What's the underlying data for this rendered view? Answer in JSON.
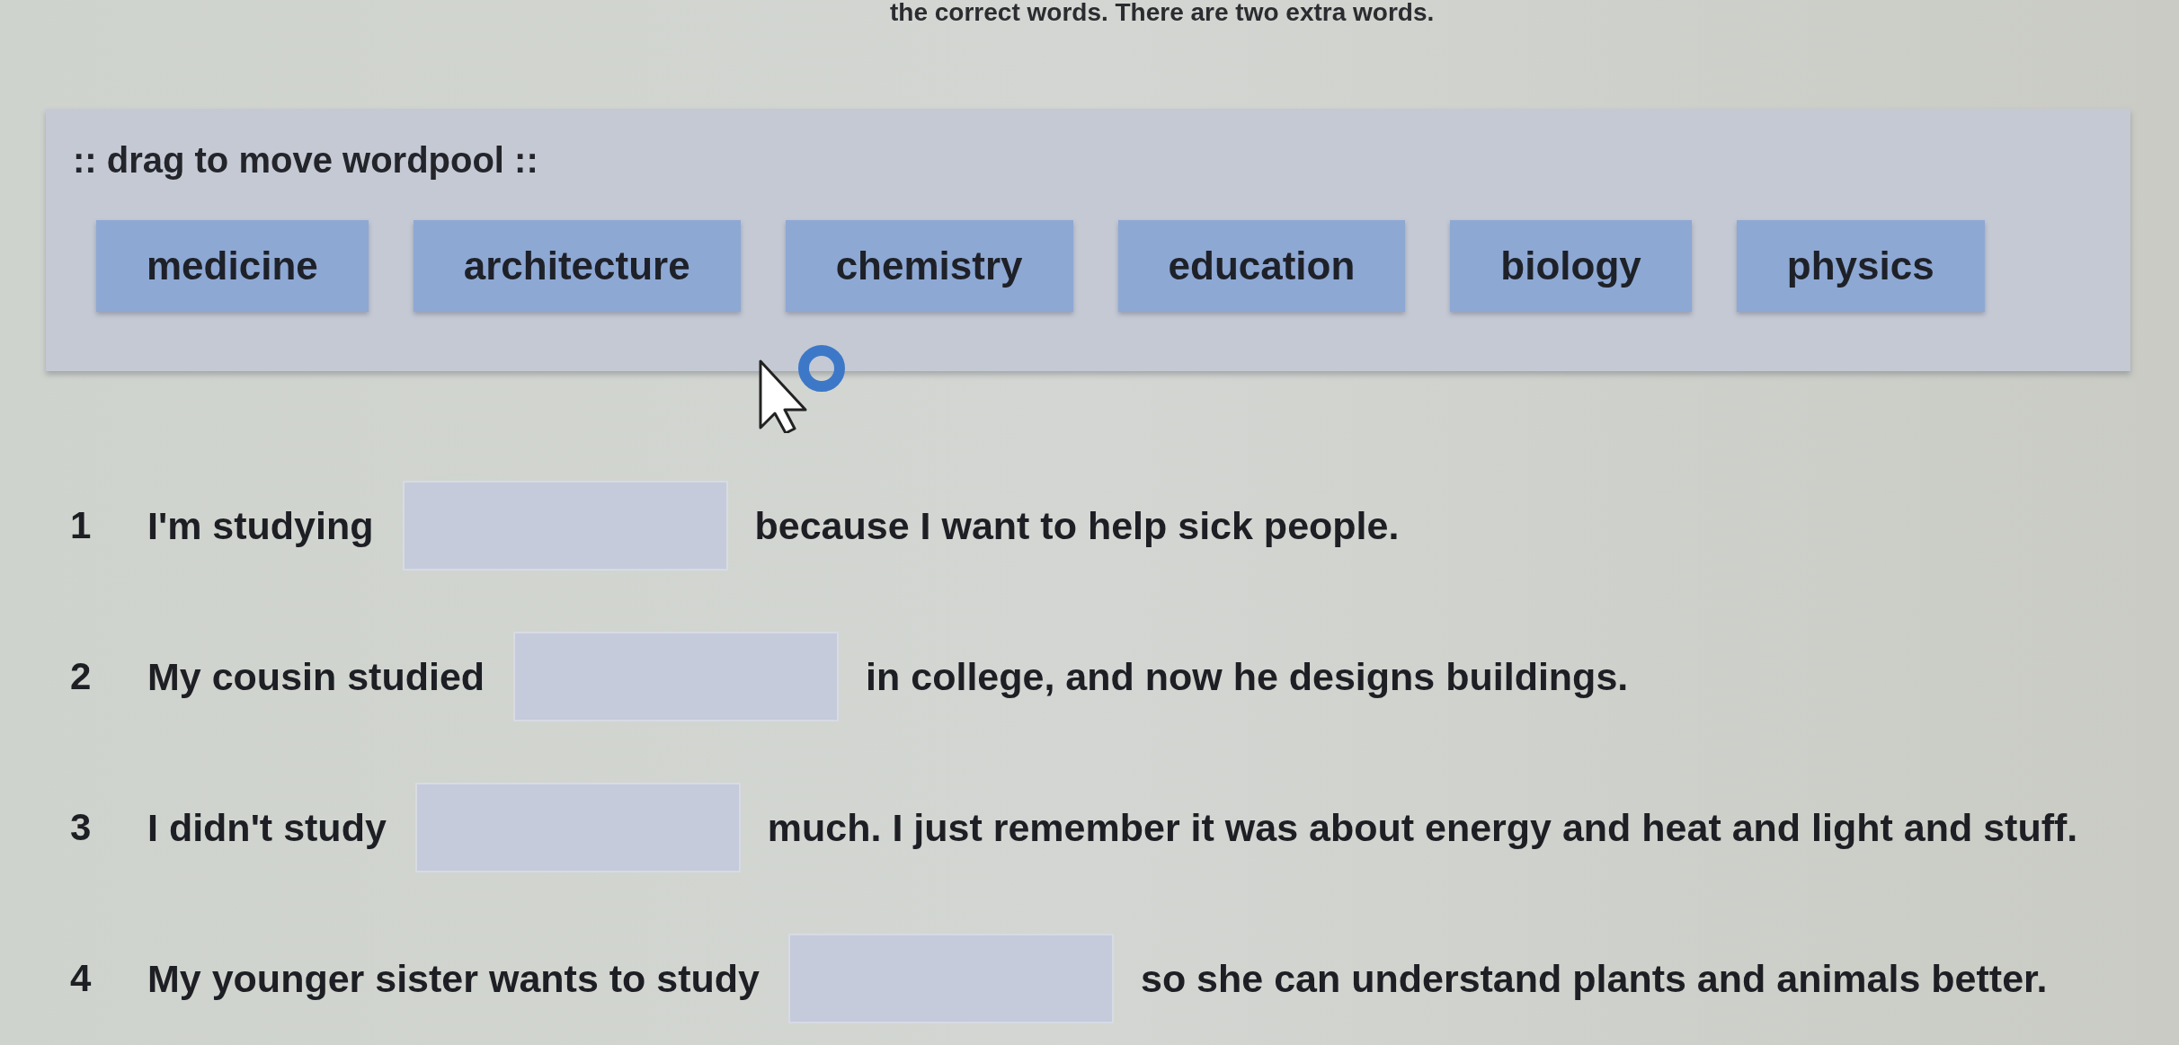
{
  "instruction": "the correct words. There are two extra words.",
  "wordpool": {
    "title": ":: drag to move wordpool ::",
    "words": [
      "medicine",
      "architecture",
      "chemistry",
      "education",
      "biology",
      "physics"
    ]
  },
  "questions": [
    {
      "number": "1",
      "before": "I'm studying",
      "after": "because I want to help sick people."
    },
    {
      "number": "2",
      "before": "My cousin studied",
      "after": "in college, and now he designs buildings."
    },
    {
      "number": "3",
      "before": "I didn't study",
      "after": "much. I just remember it was about energy and heat and light and stuff."
    },
    {
      "number": "4",
      "before": "My younger sister wants to study",
      "after": "so she can understand plants and animals better."
    }
  ]
}
